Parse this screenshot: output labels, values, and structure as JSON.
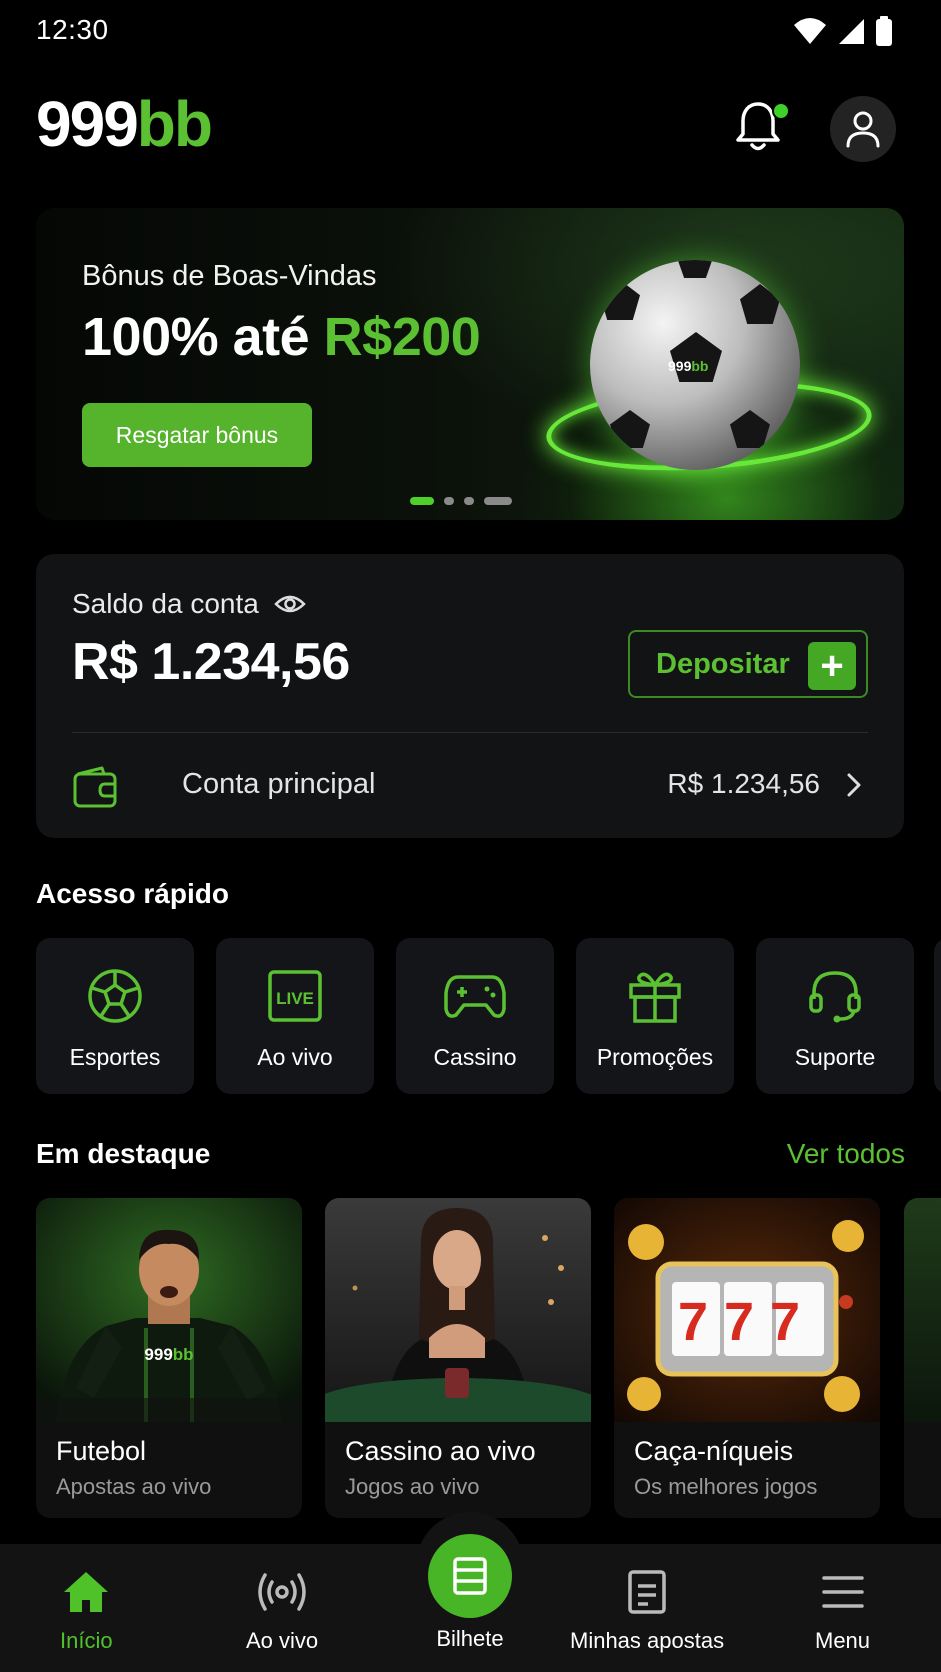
{
  "status": {
    "time": "12:30"
  },
  "header": {
    "logo_white": "999",
    "logo_green": "bb"
  },
  "banner": {
    "subtitle": "Bônus de Boas-Vindas",
    "title_prefix": "100% até ",
    "title_highlight": "R$200",
    "button": "Resgatar bônus",
    "ball_logo_white": "999",
    "ball_logo_green": "bb",
    "slides": 4,
    "active_slide": 1
  },
  "balance": {
    "label": "Saldo da conta",
    "amount": "R$ 1.234,56",
    "deposit_button": "Depositar",
    "account_label": "Conta principal",
    "account_value": "R$ 1.234,56"
  },
  "quick_access": {
    "title": "Acesso rápido",
    "items": [
      {
        "label": "Esportes",
        "icon": "soccer-ball-icon"
      },
      {
        "label": "Ao vivo",
        "icon": "live-tv-icon",
        "badge": "LIVE"
      },
      {
        "label": "Cassino",
        "icon": "gamepad-icon"
      },
      {
        "label": "Promoções",
        "icon": "gift-icon"
      },
      {
        "label": "Suporte",
        "icon": "headset-icon"
      }
    ]
  },
  "featured": {
    "title": "Em destaque",
    "see_all": "Ver todos",
    "cards": [
      {
        "title": "Futebol",
        "subtitle": "Apostas ao vivo",
        "jersey_white": "999",
        "jersey_green": "bb"
      },
      {
        "title": "Cassino ao vivo",
        "subtitle": "Jogos ao vivo"
      },
      {
        "title": "Caça-níqueis",
        "subtitle": "Os melhores jogos",
        "reels": "777"
      }
    ]
  },
  "bottom_nav": {
    "items": [
      {
        "label": "Início",
        "icon": "home-icon",
        "active": true
      },
      {
        "label": "Ao vivo",
        "icon": "broadcast-icon",
        "active": false
      },
      {
        "label": "Bilhete",
        "icon": "ticket-icon",
        "active": false
      },
      {
        "label": "Minhas apostas",
        "icon": "document-icon",
        "active": false
      },
      {
        "label": "Menu",
        "icon": "hamburger-icon",
        "active": false
      }
    ]
  },
  "colors": {
    "accent": "#5cc132",
    "background": "#000000",
    "card": "#131518"
  }
}
